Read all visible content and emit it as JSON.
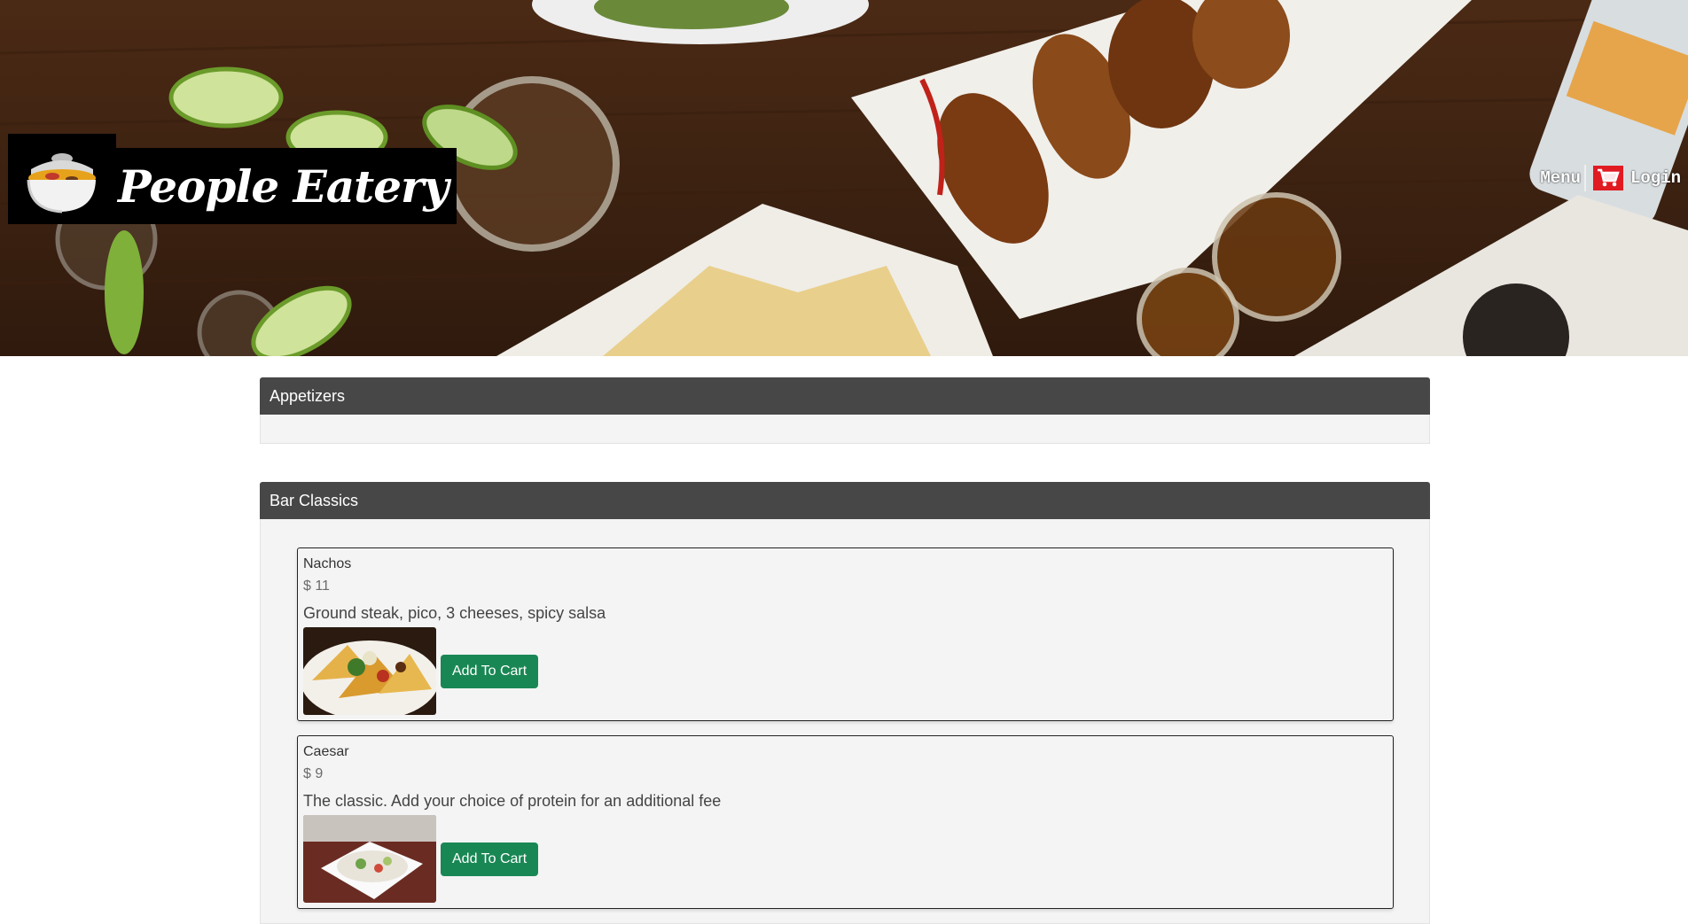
{
  "header": {
    "brand": "People Eatery",
    "logo_icon": "soup-bowl-icon",
    "nav": {
      "menu_label": "Menu",
      "cart_icon": "shopping-cart-icon",
      "login_label": "Login"
    },
    "hero_image": "food-table-photo"
  },
  "colors": {
    "category_header": "#474747",
    "add_button": "#198754",
    "cart_icon": "#e11b22"
  },
  "categories": [
    {
      "name": "Appetizers",
      "items": []
    },
    {
      "name": "Bar Classics",
      "items": [
        {
          "name": "Nachos",
          "price": "$ 11",
          "description": "Ground steak, pico, 3 cheeses, spicy salsa",
          "image": "nachos-photo",
          "button": "Add To Cart"
        },
        {
          "name": "Caesar",
          "price": "$ 9",
          "description": "The classic. Add your choice of protein for an additional fee",
          "image": "caesar-salad-photo",
          "button": "Add To Cart"
        }
      ]
    }
  ]
}
